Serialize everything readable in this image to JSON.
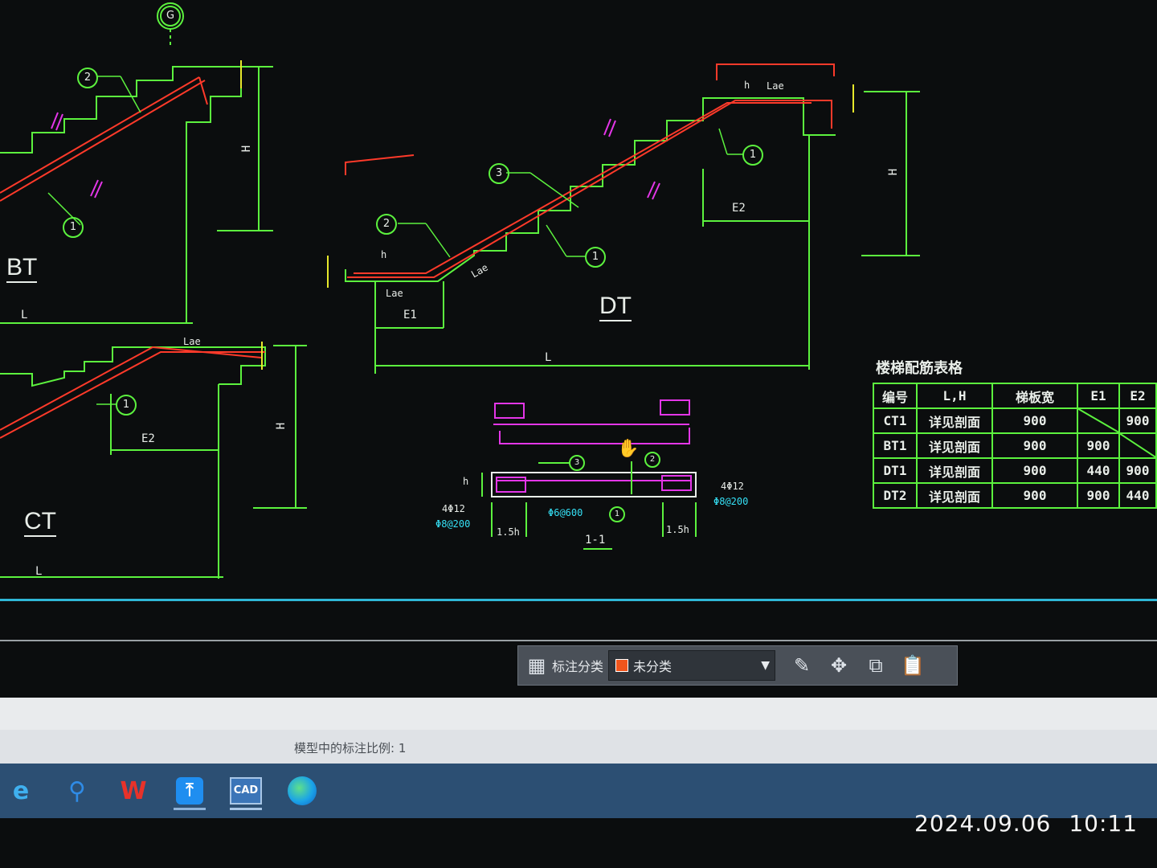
{
  "drawing": {
    "grid_bubble": "G",
    "stair_labels": {
      "bt": "BT",
      "dt": "DT",
      "ct": "CT"
    },
    "dims": {
      "L": "L",
      "H": "H",
      "E1": "E1",
      "E2": "E2",
      "h": "h",
      "Lae": "Lae"
    },
    "callouts": {
      "one": "1",
      "two": "2",
      "three": "3"
    },
    "section": {
      "title": "1-1",
      "left_bar": "4Φ12",
      "left_stirrup": "Φ8@200",
      "right_bar": "4Φ12",
      "right_stirrup": "Φ8@200",
      "mid_dist": "Φ6@600",
      "left_width": "1.5h",
      "right_width": "1.5h"
    }
  },
  "rebar_table": {
    "title": "楼梯配筋表格",
    "headers": [
      "编号",
      "L,H",
      "梯板宽",
      "E1",
      "E2"
    ],
    "rows": [
      [
        "CT1",
        "详见剖面",
        "900",
        "",
        "900"
      ],
      [
        "BT1",
        "详见剖面",
        "900",
        "900",
        ""
      ],
      [
        "DT1",
        "详见剖面",
        "900",
        "440",
        "900"
      ],
      [
        "DT2",
        "详见剖面",
        "900",
        "900",
        "440"
      ]
    ]
  },
  "annotation_toolbar": {
    "label": "标注分类",
    "selected": "未分类",
    "swatch_color": "#f0551c",
    "icons": [
      "grid-icon",
      "edit-icon",
      "move-icon",
      "copy-icon",
      "paste-icon"
    ]
  },
  "status_bar": {
    "text": "模型中的标注比例: 1"
  },
  "taskbar": {
    "apps": [
      "ie-icon",
      "search-icon",
      "wps-icon",
      "pin-icon",
      "cad-icon",
      "edge-icon"
    ],
    "cad_label": "CAD"
  },
  "photo_stamp": {
    "date": "2024.09.06",
    "time": "10:11"
  }
}
